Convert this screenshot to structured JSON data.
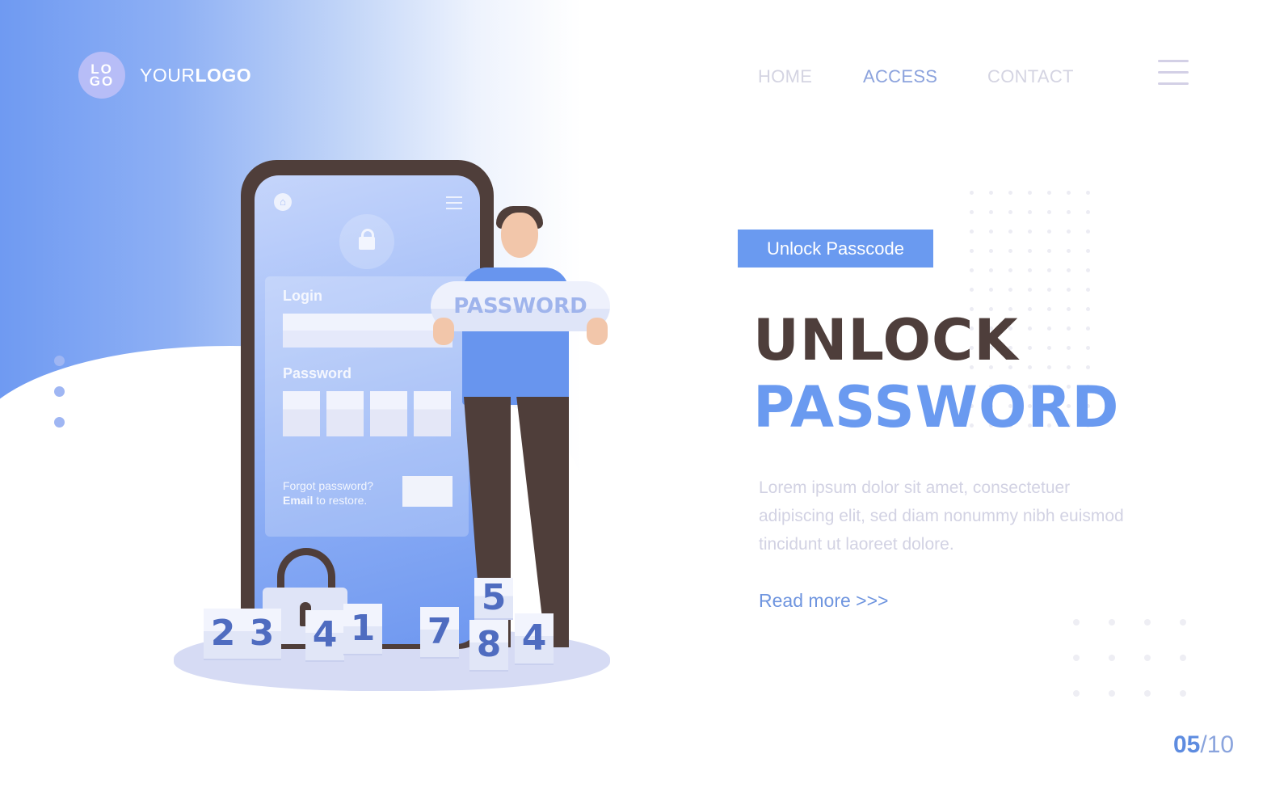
{
  "header": {
    "logo_badge_line1": "LO",
    "logo_badge_line2": "GO",
    "logo_text_light": "YOUR",
    "logo_text_bold": "LOGO",
    "nav": [
      {
        "label": "HOME",
        "active": false
      },
      {
        "label": "ACCESS",
        "active": true
      },
      {
        "label": "CONTACT",
        "active": false
      }
    ],
    "menu_icon": "hamburger-icon"
  },
  "hero": {
    "tag": "Unlock Passcode",
    "title_line1": "UNLOCK",
    "title_line2": "PASSWORD",
    "description": "Lorem ipsum dolor sit amet, consectetuer adipiscing elit, sed diam nonummy nibh euismod tincidunt ut laoreet dolore.",
    "read_more": "Read more >>>"
  },
  "illustration": {
    "phone_login_label": "Login",
    "phone_password_label": "Password",
    "forgot_line1": "Forgot password?",
    "forgot_bold": "Email",
    "forgot_rest": " to restore.",
    "sign_text": "PASSWORD",
    "tiles_left": [
      "2",
      "3",
      "4",
      "1"
    ],
    "tiles_right": [
      "7",
      "8",
      "4"
    ],
    "tiles_back": [
      "5"
    ]
  },
  "pager": {
    "current": "05",
    "total": "/10"
  },
  "colors": {
    "accent": "#6a9af0",
    "title_dark": "#4e3e3b",
    "nav_active": "#8ca3dd",
    "nav_inactive": "#d4d4e2"
  }
}
